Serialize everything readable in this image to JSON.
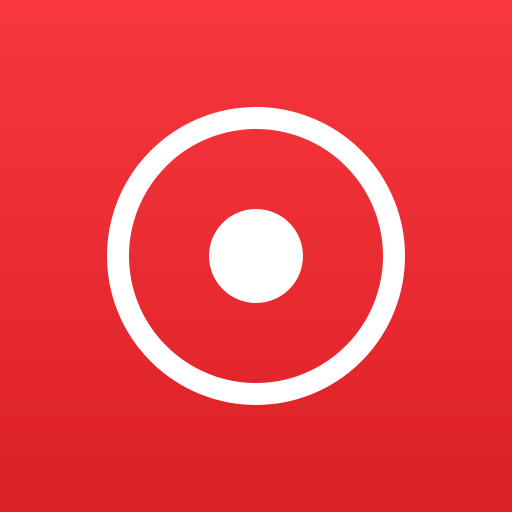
{
  "icon": {
    "name": "record-icon",
    "colors": {
      "background_top": "#F8373F",
      "background_bottom": "#DB2126",
      "symbol": "#FFFFFF"
    }
  }
}
